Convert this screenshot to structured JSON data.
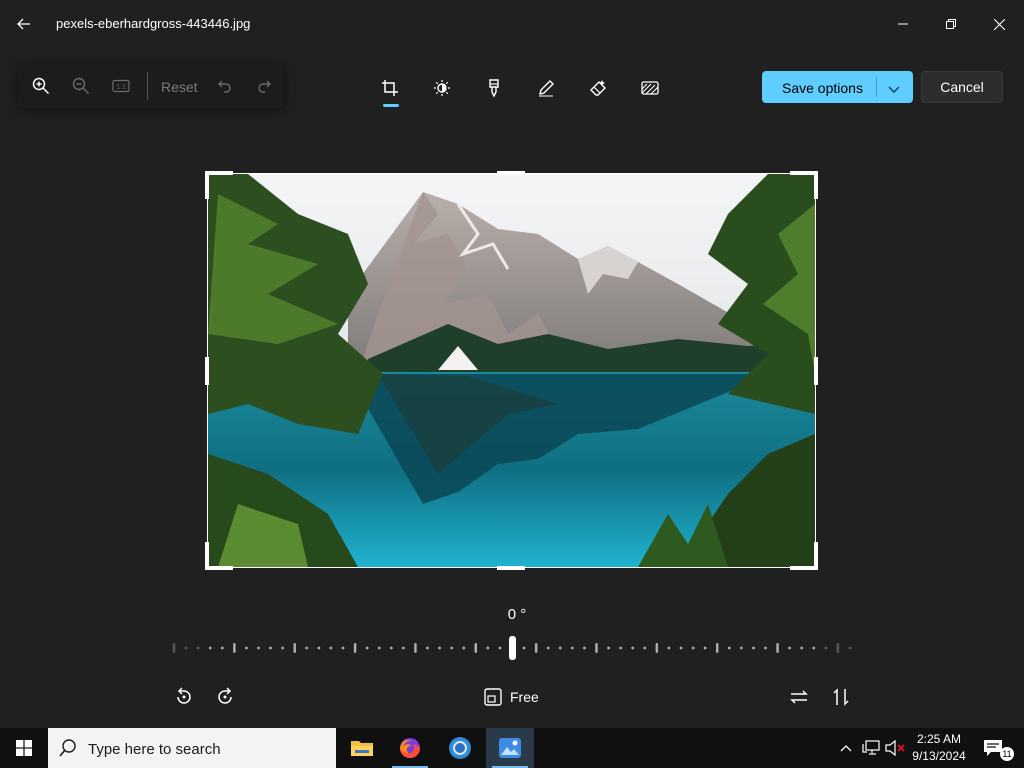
{
  "titlebar": {
    "file_name": "pexels-eberhardgross-443446.jpg",
    "icons": [
      "back-arrow-icon",
      "minimize-icon",
      "maximize-icon",
      "close-icon"
    ]
  },
  "view_toolbar": {
    "reset_label": "Reset",
    "actual_size_label": "1:1",
    "icons": [
      "zoom-in-icon",
      "zoom-out-icon",
      "actual-size-icon",
      "undo-icon",
      "redo-icon"
    ]
  },
  "edit_tabs": [
    {
      "name": "crop",
      "icon": "crop-icon",
      "selected": true
    },
    {
      "name": "adjustment",
      "icon": "brightness-icon",
      "selected": false
    },
    {
      "name": "filter",
      "icon": "filter-icon",
      "selected": false
    },
    {
      "name": "markup",
      "icon": "pen-icon",
      "selected": false
    },
    {
      "name": "erase",
      "icon": "eraser-icon",
      "selected": false
    },
    {
      "name": "background",
      "icon": "background-blur-icon",
      "selected": false
    }
  ],
  "actions": {
    "save_label": "Save options",
    "cancel_label": "Cancel"
  },
  "straighten": {
    "angle_label": "0 °",
    "angle_value": 0,
    "range": [
      -45,
      45
    ]
  },
  "crop_tools": {
    "aspect_label": "Free",
    "icons": [
      "rotate-left-icon",
      "rotate-right-icon",
      "aspect-ratio-icon",
      "flip-horizontal-icon",
      "flip-vertical-icon"
    ]
  },
  "taskbar": {
    "search_placeholder": "Type here to search",
    "apps": [
      {
        "name": "file-explorer",
        "icon": "folder-icon",
        "active": false
      },
      {
        "name": "firefox",
        "icon": "firefox-icon",
        "active": false
      },
      {
        "name": "chrome",
        "icon": "chrome-icon",
        "active": false
      },
      {
        "name": "photos",
        "icon": "photos-icon",
        "active": true
      }
    ],
    "time": "2:25 AM",
    "date": "9/13/2024",
    "notification_count": "11"
  },
  "colors": {
    "background": "#202020",
    "accent": "#60cdff",
    "taskbar": "#101010"
  }
}
